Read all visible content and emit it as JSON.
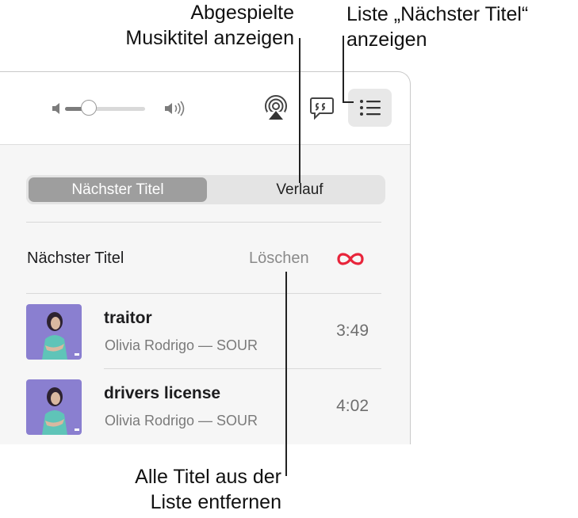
{
  "callouts": {
    "history": {
      "line1": "Abgespielte",
      "line2": "Musiktitel anzeigen"
    },
    "up_next": {
      "line1": "Liste „Nächster Titel“",
      "line2": "anzeigen"
    },
    "clear": {
      "line1": "Alle Titel aus der",
      "line2": "Liste entfernen"
    }
  },
  "toolbar": {
    "volume": 0.3,
    "icons": [
      "speaker-low-icon",
      "speaker-high-icon",
      "airplay-icon",
      "lyrics-icon",
      "queue-list-icon"
    ]
  },
  "segmented": {
    "selected": "Nächster Titel",
    "other": "Verlauf"
  },
  "queue": {
    "title": "Nächster Titel",
    "clear_label": "Löschen",
    "tracks": [
      {
        "title": "traitor",
        "subtitle": "Olivia Rodrigo — SOUR",
        "duration": "3:49"
      },
      {
        "title": "drivers license",
        "subtitle": "Olivia Rodrigo — SOUR",
        "duration": "4:02"
      }
    ]
  },
  "colors": {
    "accent_red": "#e8253b",
    "art_background": "#8a7fd0"
  }
}
